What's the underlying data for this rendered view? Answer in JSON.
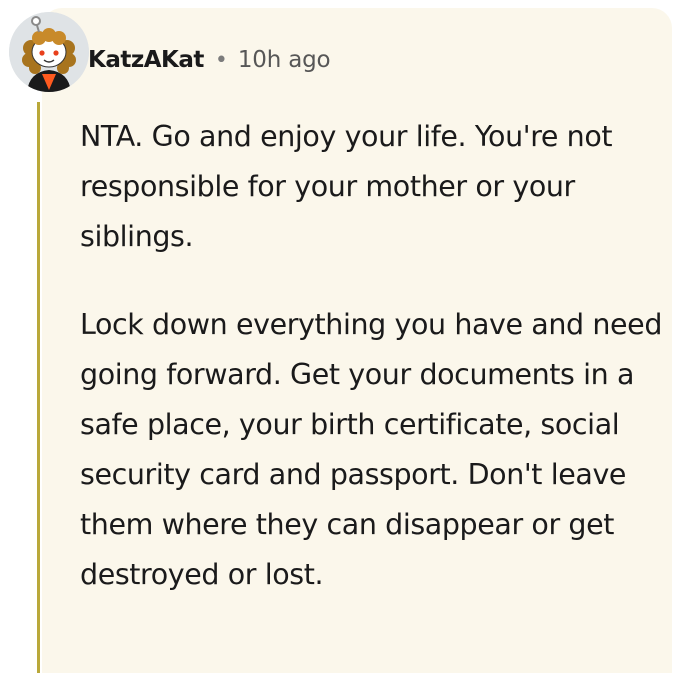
{
  "comment": {
    "author": "KatzAKat",
    "separator": "•",
    "timestamp": "10h ago",
    "paragraphs": [
      "NTA. Go and enjoy your life. You're not responsible for your mother or your siblings.",
      "Lock down everything you have and need going forward. Get your documents in a safe place, your birth certificate, social security card and passport. Don't leave them where they can disappear or get destroyed or lost."
    ]
  },
  "colors": {
    "card_background": "#fbf7eb",
    "thread_line": "#b9a83a",
    "text": "#1a1a1b",
    "meta_text": "#575757"
  },
  "icons": {
    "avatar": "snoo-avatar-icon"
  }
}
